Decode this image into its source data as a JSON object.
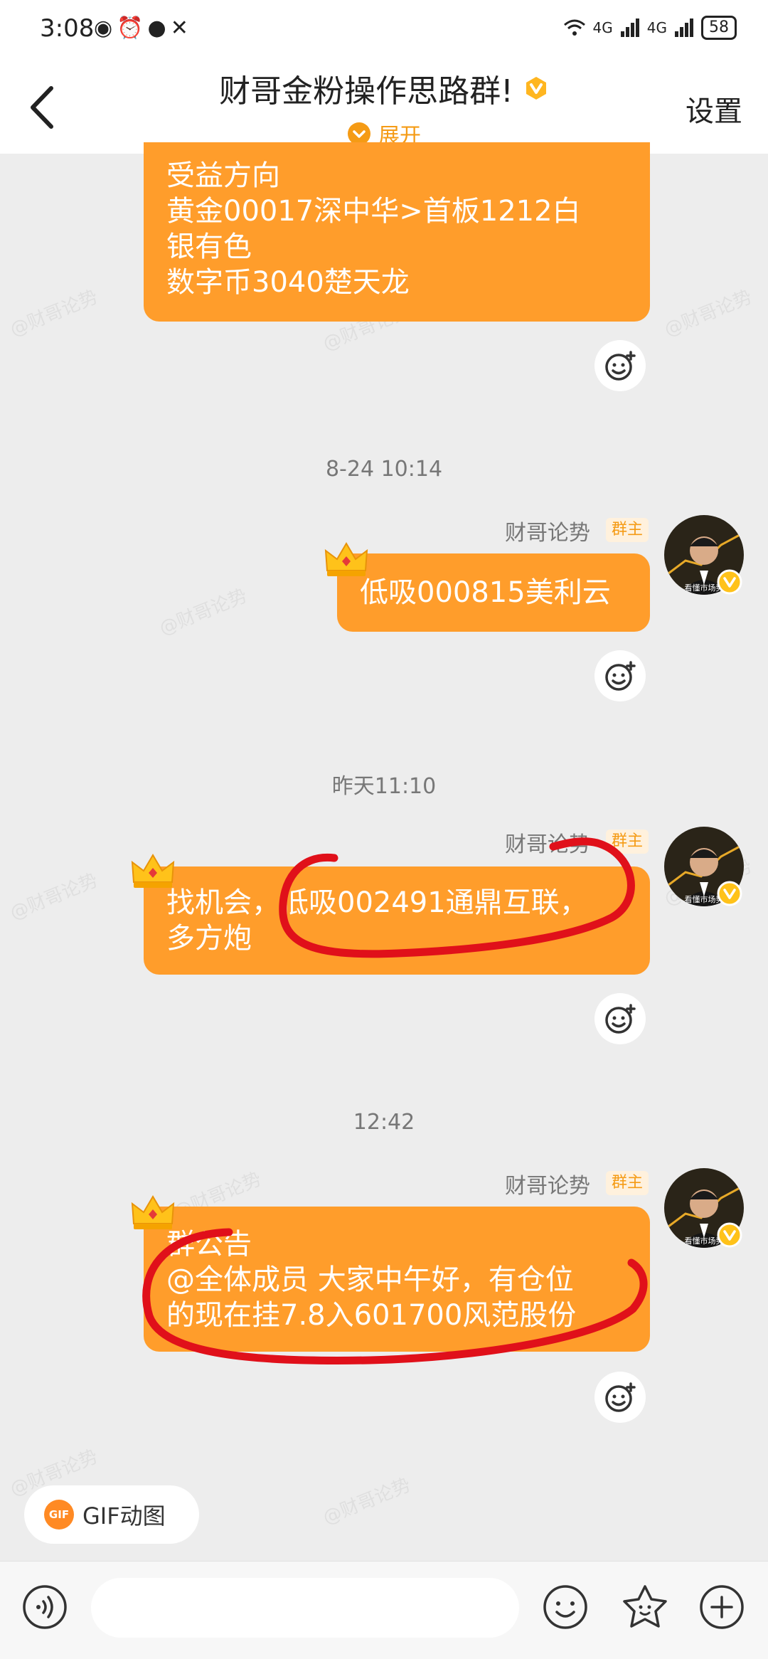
{
  "status_bar": {
    "time": "3:08",
    "net_1": "4G",
    "net_2": "4G",
    "battery": "58"
  },
  "header": {
    "title": "财哥金粉操作思路群!",
    "expand_label": "展开",
    "settings_label": "设置"
  },
  "messages": [
    {
      "lines": [
        "受益方向",
        "黄金00017深中华>首板1212白",
        "银有色",
        "数字币3040楚天龙"
      ]
    },
    {
      "timestamp": "8-24 10:14",
      "sender": "财哥论势",
      "role": "群主",
      "lines": [
        "低吸000815美利云"
      ]
    },
    {
      "timestamp": "昨天11:10",
      "sender": "财哥论势",
      "role": "群主",
      "lines": [
        "找机会，低吸002491通鼎互联，",
        "多方炮"
      ]
    },
    {
      "timestamp": "12:42",
      "sender": "财哥论势",
      "role": "群主",
      "lines": [
        "群公告",
        "@全体成员 大家中午好，有仓位",
        "的现在挂7.8入601700风范股份"
      ]
    }
  ],
  "avatar_caption": "看懂市场势",
  "watermark": "@财哥论势",
  "gif_chip": {
    "badge": "GIF",
    "label": "GIF动图"
  },
  "input": {
    "placeholder": ""
  },
  "colors": {
    "bubble": "#ff9d2b",
    "accent": "#f59b15",
    "annotation": "#e0101a",
    "background": "#ededed"
  },
  "icons": [
    "back-icon",
    "vip-icon",
    "expand-chevron-icon",
    "emoji-react-icon",
    "crown-icon",
    "verified-icon",
    "voice-icon",
    "emoji-icon",
    "sticker-icon",
    "plus-icon"
  ]
}
